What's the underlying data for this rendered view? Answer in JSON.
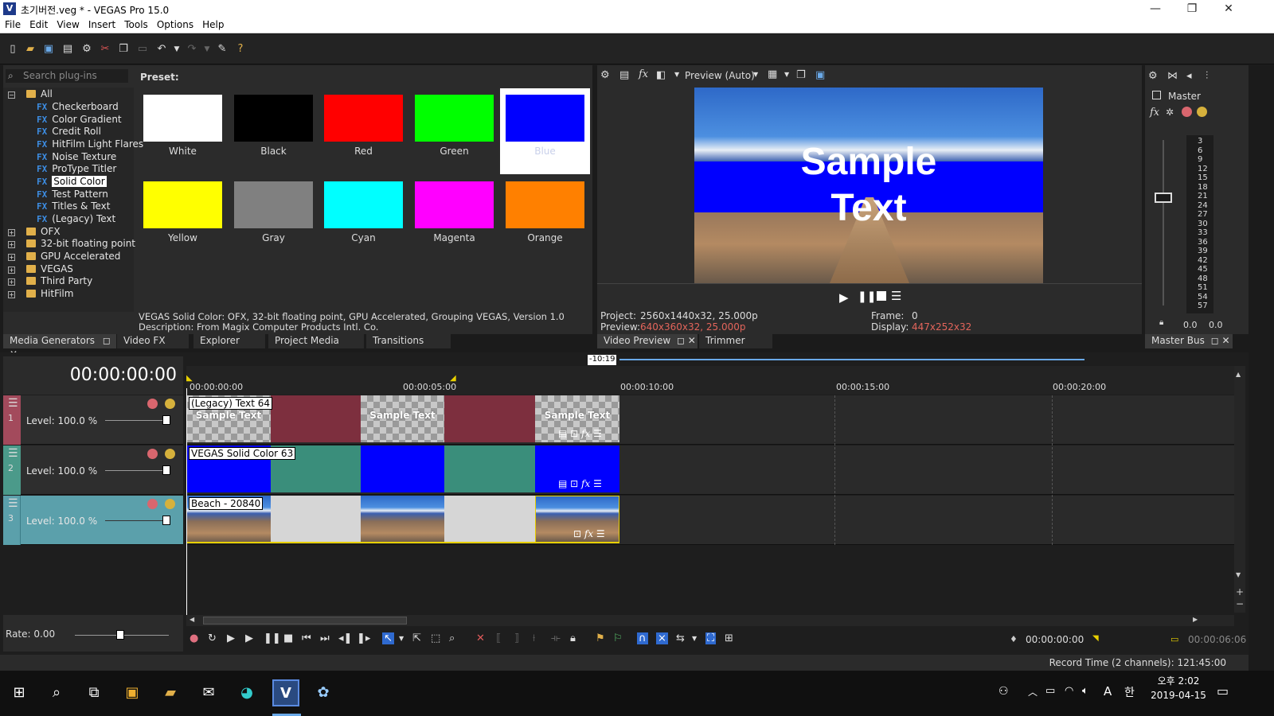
{
  "window": {
    "title": "초기버전.veg * - VEGAS Pro 15.0",
    "app_icon": "V",
    "min": "—",
    "max": "❐",
    "close": "✕"
  },
  "menu": [
    "File",
    "Edit",
    "View",
    "Insert",
    "Tools",
    "Options",
    "Help"
  ],
  "plugins": {
    "search_placeholder": "Search plug-ins",
    "preset_label": "Preset:",
    "tree": {
      "all": "All",
      "fx_items": [
        "Checkerboard",
        "Color Gradient",
        "Credit Roll",
        "HitFilm Light Flares",
        "Noise Texture",
        "ProType Titler",
        "Solid Color",
        "Test Pattern",
        "Titles & Text",
        "(Legacy) Text"
      ],
      "selected": "Solid Color",
      "folders": [
        "OFX",
        "32-bit floating point",
        "GPU Accelerated",
        "VEGAS",
        "Third Party",
        "HitFilm"
      ]
    },
    "presets": [
      {
        "name": "White",
        "color": "#ffffff"
      },
      {
        "name": "Black",
        "color": "#000000"
      },
      {
        "name": "Red",
        "color": "#ff0000"
      },
      {
        "name": "Green",
        "color": "#00ff00"
      },
      {
        "name": "Blue",
        "color": "#0000ff"
      },
      {
        "name": "Yellow",
        "color": "#ffff00"
      },
      {
        "name": "Gray",
        "color": "#808080"
      },
      {
        "name": "Cyan",
        "color": "#00ffff"
      },
      {
        "name": "Magenta",
        "color": "#ff00ff"
      },
      {
        "name": "Orange",
        "color": "#ff8000"
      }
    ],
    "selected_preset": "Blue",
    "info_line1": "VEGAS Solid Color: OFX, 32-bit floating point, GPU Accelerated, Grouping VEGAS, Version 1.0",
    "info_line2": "Description: From Magix Computer Products Intl. Co.",
    "tabs": [
      "Media Generators",
      "Video FX",
      "Explorer",
      "Project Media",
      "Transitions"
    ]
  },
  "preview": {
    "mode": "Preview (Auto)",
    "overlay_line1": "Sample",
    "overlay_line2": "Text",
    "project_label": "Project:",
    "project_value": "2560x1440x32, 25.000p",
    "preview_label": "Preview:",
    "preview_value": "640x360x32, 25.000p",
    "frame_label": "Frame:",
    "frame_value": "0",
    "display_label": "Display:",
    "display_value": "447x252x32",
    "tabs": [
      "Video Preview",
      "Trimmer"
    ]
  },
  "master": {
    "label": "Master",
    "scale": [
      "3",
      "6",
      "9",
      "12",
      "15",
      "18",
      "21",
      "24",
      "27",
      "30",
      "33",
      "36",
      "39",
      "42",
      "45",
      "48",
      "51",
      "54",
      "57"
    ],
    "left_value": "0.0",
    "right_value": "0.0",
    "tab": "Master Bus"
  },
  "timeline": {
    "timecode": "00:00:00:00",
    "loop_marker": "-10:19",
    "ruler": [
      "00:00:00:00",
      "00:00:05:00",
      "00:00:10:00",
      "00:00:15:00",
      "00:00:20:00"
    ],
    "tracks": [
      {
        "num": "1",
        "level": "Level: 100.0 %",
        "color": "#a34a5c",
        "clip_label": "(Legacy) Text 64"
      },
      {
        "num": "2",
        "level": "Level: 100.0 %",
        "color": "#4b9a8a",
        "clip_label": "VEGAS Solid Color 63"
      },
      {
        "num": "3",
        "level": "Level: 100.0 %",
        "color": "#5ba0ab",
        "clip_label": "Beach - 20840"
      }
    ],
    "sample_text": "Sample Text",
    "rate": "Rate: 0.00",
    "cursor_time": "00:00:00:00",
    "end_time": "00:00:06:06",
    "record_time": "Record Time (2 channels): 121:45:00"
  },
  "taskbar": {
    "time": "오후 2:02",
    "date": "2019-04-15",
    "ime": "A",
    "ime2": "한"
  }
}
